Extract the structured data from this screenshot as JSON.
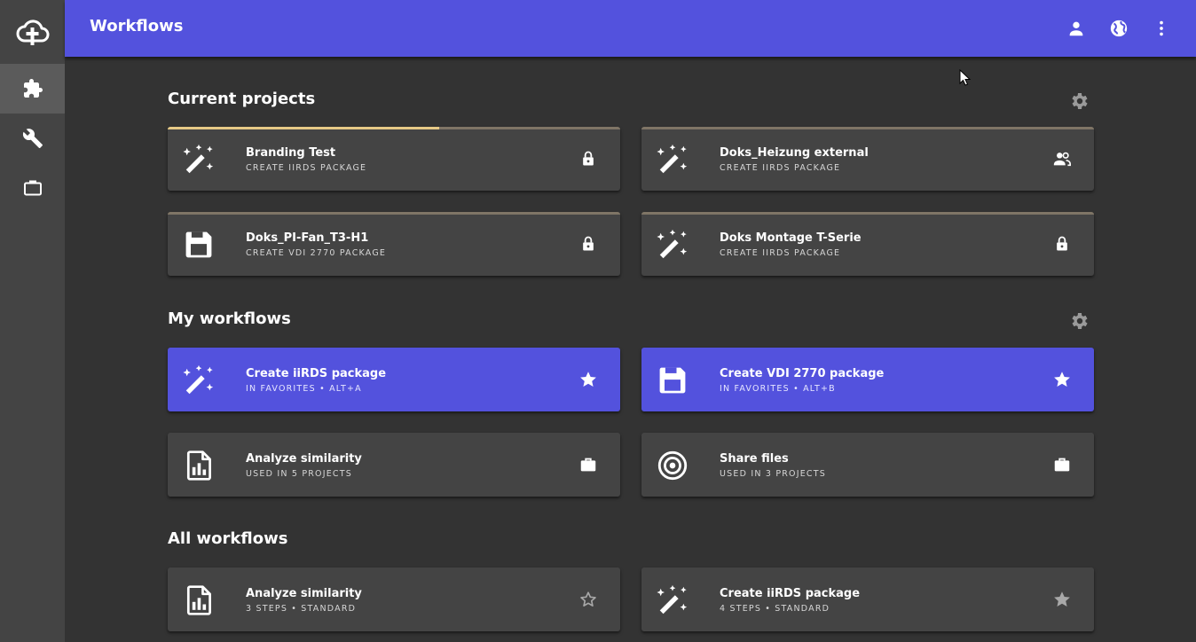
{
  "topbar": {
    "title": "Workflows",
    "actions": [
      "account-icon",
      "globe-icon",
      "more-vert-icon"
    ]
  },
  "rail": {
    "logo": "cloud-plus-icon",
    "items": [
      {
        "icon": "puzzle-icon",
        "active": true
      },
      {
        "icon": "wrench-icon",
        "active": false
      },
      {
        "icon": "briefcase-icon",
        "active": false
      }
    ]
  },
  "sections": {
    "current": {
      "title": "Current projects",
      "cards": [
        {
          "title": "Branding Test",
          "subtitle": "CREATE IIRDS PACKAGE",
          "icon": "magic-wand-icon",
          "action": "lock-icon",
          "progress": 0.6
        },
        {
          "title": "Doks_Heizung external",
          "subtitle": "CREATE IIRDS PACKAGE",
          "icon": "magic-wand-icon",
          "action": "users-icon"
        },
        {
          "title": "Doks_PI-Fan_T3-H1",
          "subtitle": "CREATE VDI 2770 PACKAGE",
          "icon": "floppy-icon",
          "action": "lock-icon"
        },
        {
          "title": "Doks Montage T-Serie",
          "subtitle": "CREATE IIRDS PACKAGE",
          "icon": "magic-wand-icon",
          "action": "lock-icon"
        }
      ]
    },
    "mine": {
      "title": "My workflows",
      "cards": [
        {
          "title": "Create iiRDS package",
          "subtitle": "IN FAVORITES • ALT+A",
          "icon": "magic-wand-icon",
          "action": "star-icon"
        },
        {
          "title": "Create VDI 2770 package",
          "subtitle": "IN FAVORITES • ALT+B",
          "icon": "floppy-icon",
          "action": "star-icon"
        },
        {
          "title": "Analyze similarity",
          "subtitle": "USED IN 5 PROJECTS",
          "icon": "chart-file-icon",
          "action": "briefcase-icon"
        },
        {
          "title": "Share files",
          "subtitle": "USED IN 3 PROJECTS",
          "icon": "target-icon",
          "action": "briefcase-icon"
        }
      ]
    },
    "all": {
      "title": "All workflows",
      "cards": [
        {
          "title": "Analyze similarity",
          "subtitle": "3 STEPS • STANDARD",
          "icon": "chart-file-icon",
          "action": "star-outline-icon"
        },
        {
          "title": "Create iiRDS package",
          "subtitle": "4 STEPS • STANDARD",
          "icon": "magic-wand-icon",
          "action": "star-icon"
        }
      ]
    }
  },
  "colors": {
    "accent": "#5352dd",
    "background": "#333333",
    "card": "#444444",
    "rail": "#444444",
    "progress": "#e6c986"
  }
}
